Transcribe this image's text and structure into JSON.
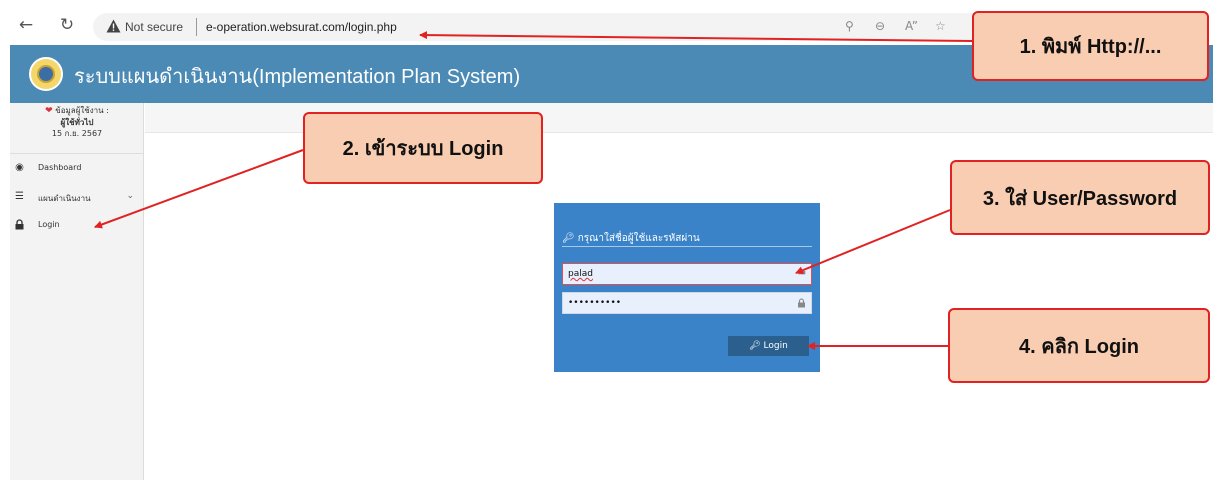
{
  "browser": {
    "back_icon": "back-arrow-icon",
    "reload_icon": "reload-icon",
    "security_label": "Not secure",
    "url": "e-operation.websurat.com/login.php"
  },
  "app": {
    "title": "ระบบแผนดำเนินงาน(Implementation Plan System)"
  },
  "sidebar": {
    "user_info_label": "ข้อมูลผู้ใช้งาน :",
    "user_name": "ผู้ใช้ทั่วไป",
    "date": "15 ก.ย. 2567",
    "items": [
      {
        "label": "Dashboard",
        "icon": "dashboard-icon"
      },
      {
        "label": "แผนดำเนินงาน",
        "icon": "list-icon"
      },
      {
        "label": "Login",
        "icon": "lock-icon"
      }
    ]
  },
  "login": {
    "title": "กรุณาใส่ชื่อผู้ใช้และรหัสผ่าน",
    "username_value": "palad",
    "password_value": "••••••••••",
    "button_label": "Login"
  },
  "callouts": {
    "step1": "1. พิมพ์ Http://...",
    "step2": "2. เข้าระบบ Login",
    "step3": "3. ใส่ User/Password",
    "step4": "4. คลิก Login"
  },
  "colors": {
    "header": "#4a8ab5",
    "login_panel": "#3b83c9",
    "login_button": "#2a5f8e",
    "callout_fill": "#f9cdb1",
    "callout_border": "#e02222"
  }
}
